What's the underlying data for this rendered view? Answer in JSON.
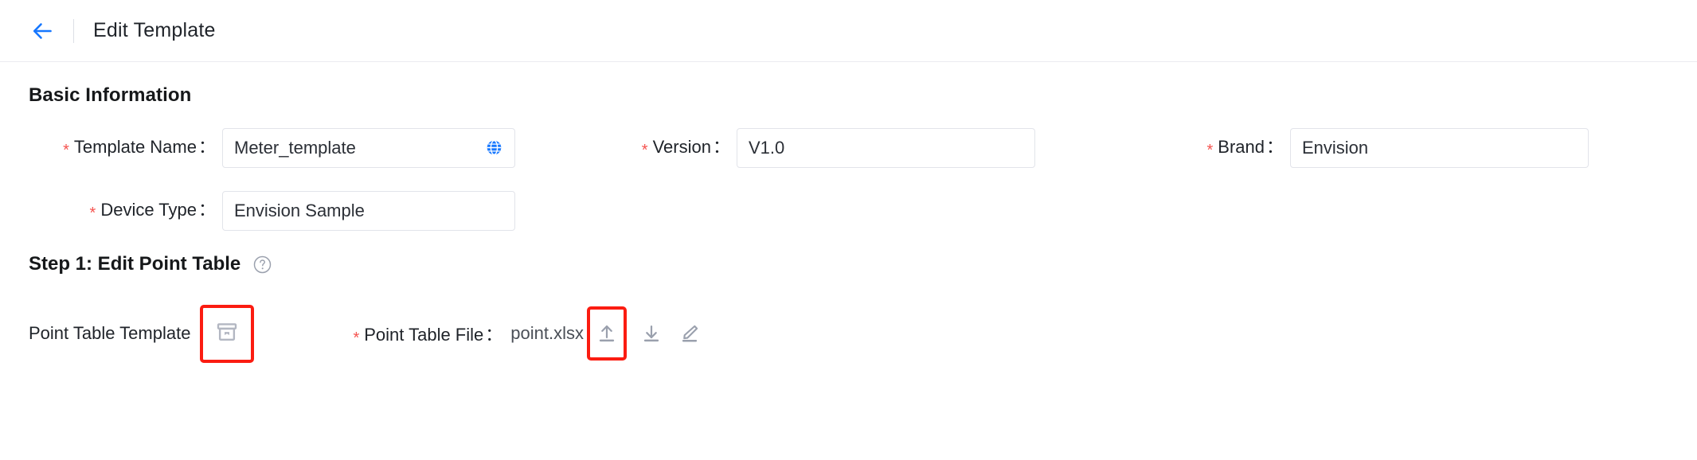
{
  "header": {
    "back_icon": "arrow-left-icon",
    "title": "Edit Template",
    "accent_color": "#1677ff"
  },
  "basic_information": {
    "section_title": "Basic Information",
    "fields": [
      {
        "label": "Template Name",
        "colon": "：",
        "required": true,
        "value": "Meter_template",
        "trailing_icon": "globe-icon"
      },
      {
        "label": "Version",
        "colon": "：",
        "required": true,
        "value": "V1.0"
      },
      {
        "label": "Brand",
        "colon": "：",
        "required": true,
        "value": "Envision"
      },
      {
        "label": "Device Type",
        "colon": "：",
        "required": true,
        "value": "Envision Sample"
      }
    ],
    "required_marker": "*"
  },
  "step_one": {
    "title": "Step 1: Edit Point Table",
    "help_icon": "question-circle-icon",
    "point_table_template": {
      "label": "Point Table Template",
      "icon": "archive-box-icon",
      "highlighted": true
    },
    "point_table_file": {
      "label": "Point Table File",
      "colon": "：",
      "required": true,
      "file_name": "point.xlsx",
      "actions": [
        {
          "name": "upload-icon",
          "highlighted": true
        },
        {
          "name": "download-icon",
          "highlighted": false
        },
        {
          "name": "edit-icon",
          "highlighted": false
        }
      ]
    }
  },
  "annotation": {
    "color": "#fb1c11"
  }
}
